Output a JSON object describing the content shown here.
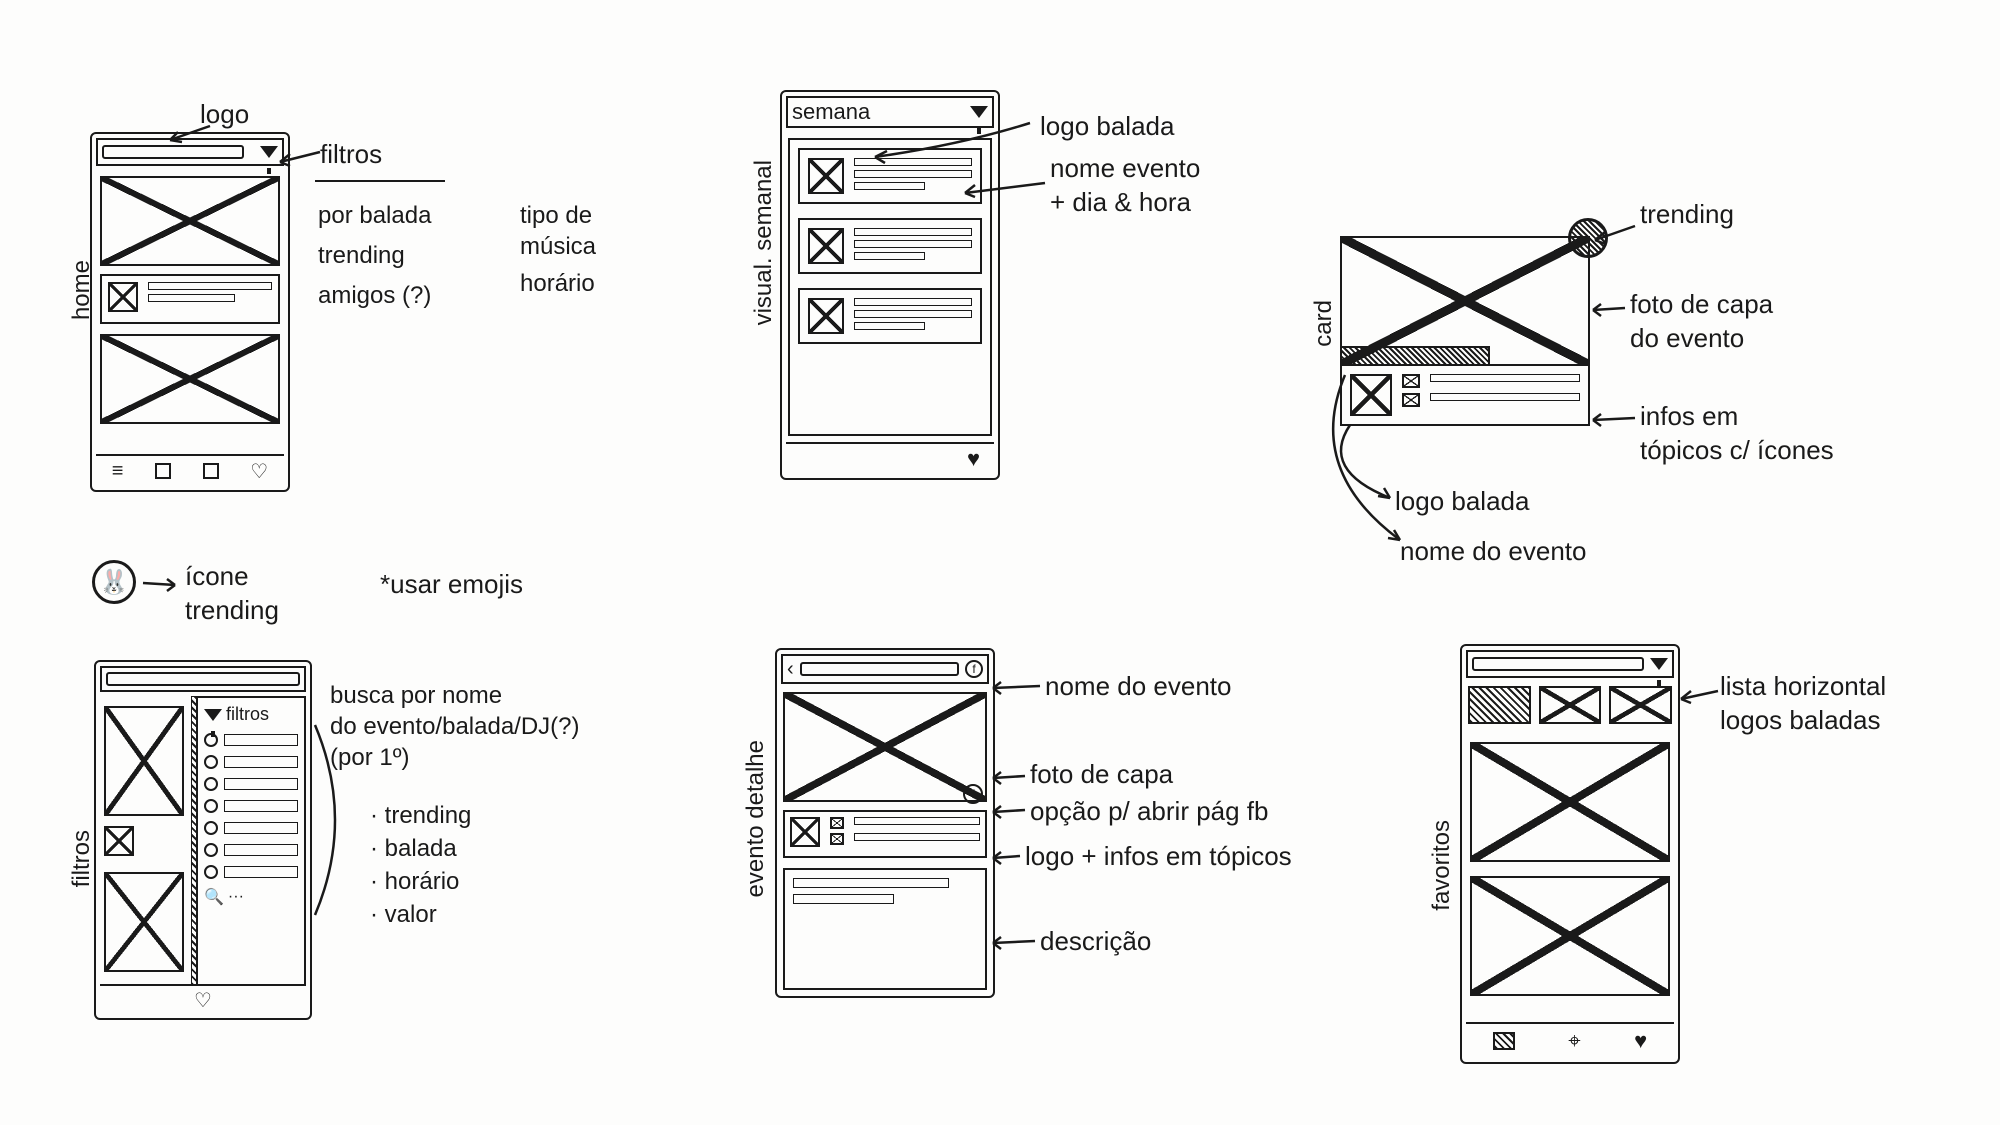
{
  "labels": {
    "home": "home",
    "visual_semanal": "visual. semanal",
    "card": "card",
    "filtros_v": "filtros",
    "evento_detalhe": "evento detalhe",
    "favoritos": "favoritos"
  },
  "notes": {
    "logo": "logo",
    "filtros": "filtros",
    "por_balada": "por balada",
    "trending": "trending",
    "amigos": "amigos (?)",
    "tipo_musica": "tipo de\nmúsica",
    "horario": "horário",
    "semana": "semana",
    "logo_balada": "logo balada",
    "nome_evento_dia": "nome evento\n+ dia & hora",
    "trending_card": "trending",
    "foto_capa_evento": "foto de capa\ndo evento",
    "infos_topicos": "infos em\ntópicos c/ ícones",
    "logo_balada2": "logo balada",
    "nome_do_evento": "nome do evento",
    "icone_trending": "ícone\ntrending",
    "usar_emojis": "*usar emojis",
    "filtros_title": "filtros",
    "busca_nome": "busca por nome\ndo evento/balada/DJ(?)\n(por 1º)",
    "f_trending": "· trending",
    "f_balada": "· balada",
    "f_horario": "· horário",
    "f_valor": "· valor",
    "nome_do_evento2": "nome do evento",
    "foto_de_capa": "foto de capa",
    "opcao_fb": "opção p/ abrir pág fb",
    "logo_infos": "logo + infos em tópicos",
    "descricao": "descrição",
    "lista_horizontal": "lista horizontal\nlogos baladas"
  }
}
